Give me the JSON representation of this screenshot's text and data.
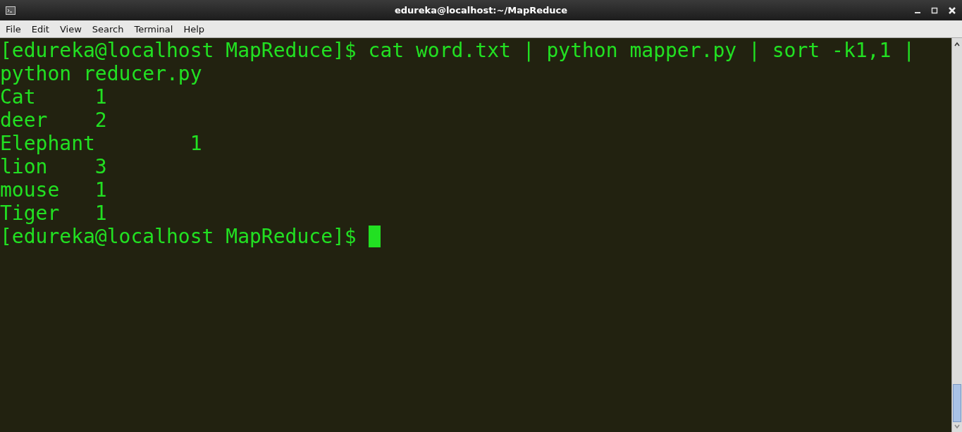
{
  "window": {
    "title": "edureka@localhost:~/MapReduce"
  },
  "menu": [
    "File",
    "Edit",
    "View",
    "Search",
    "Terminal",
    "Help"
  ],
  "terminal": {
    "lines": [
      "[edureka@localhost MapReduce]$ cat word.txt | python mapper.py | sort -k1,1 |",
      "python reducer.py",
      "Cat\t1",
      "deer\t2",
      "Elephant\t1",
      "lion\t3",
      "mouse\t1",
      "Tiger\t1"
    ],
    "prompt": "[edureka@localhost MapReduce]$ "
  }
}
